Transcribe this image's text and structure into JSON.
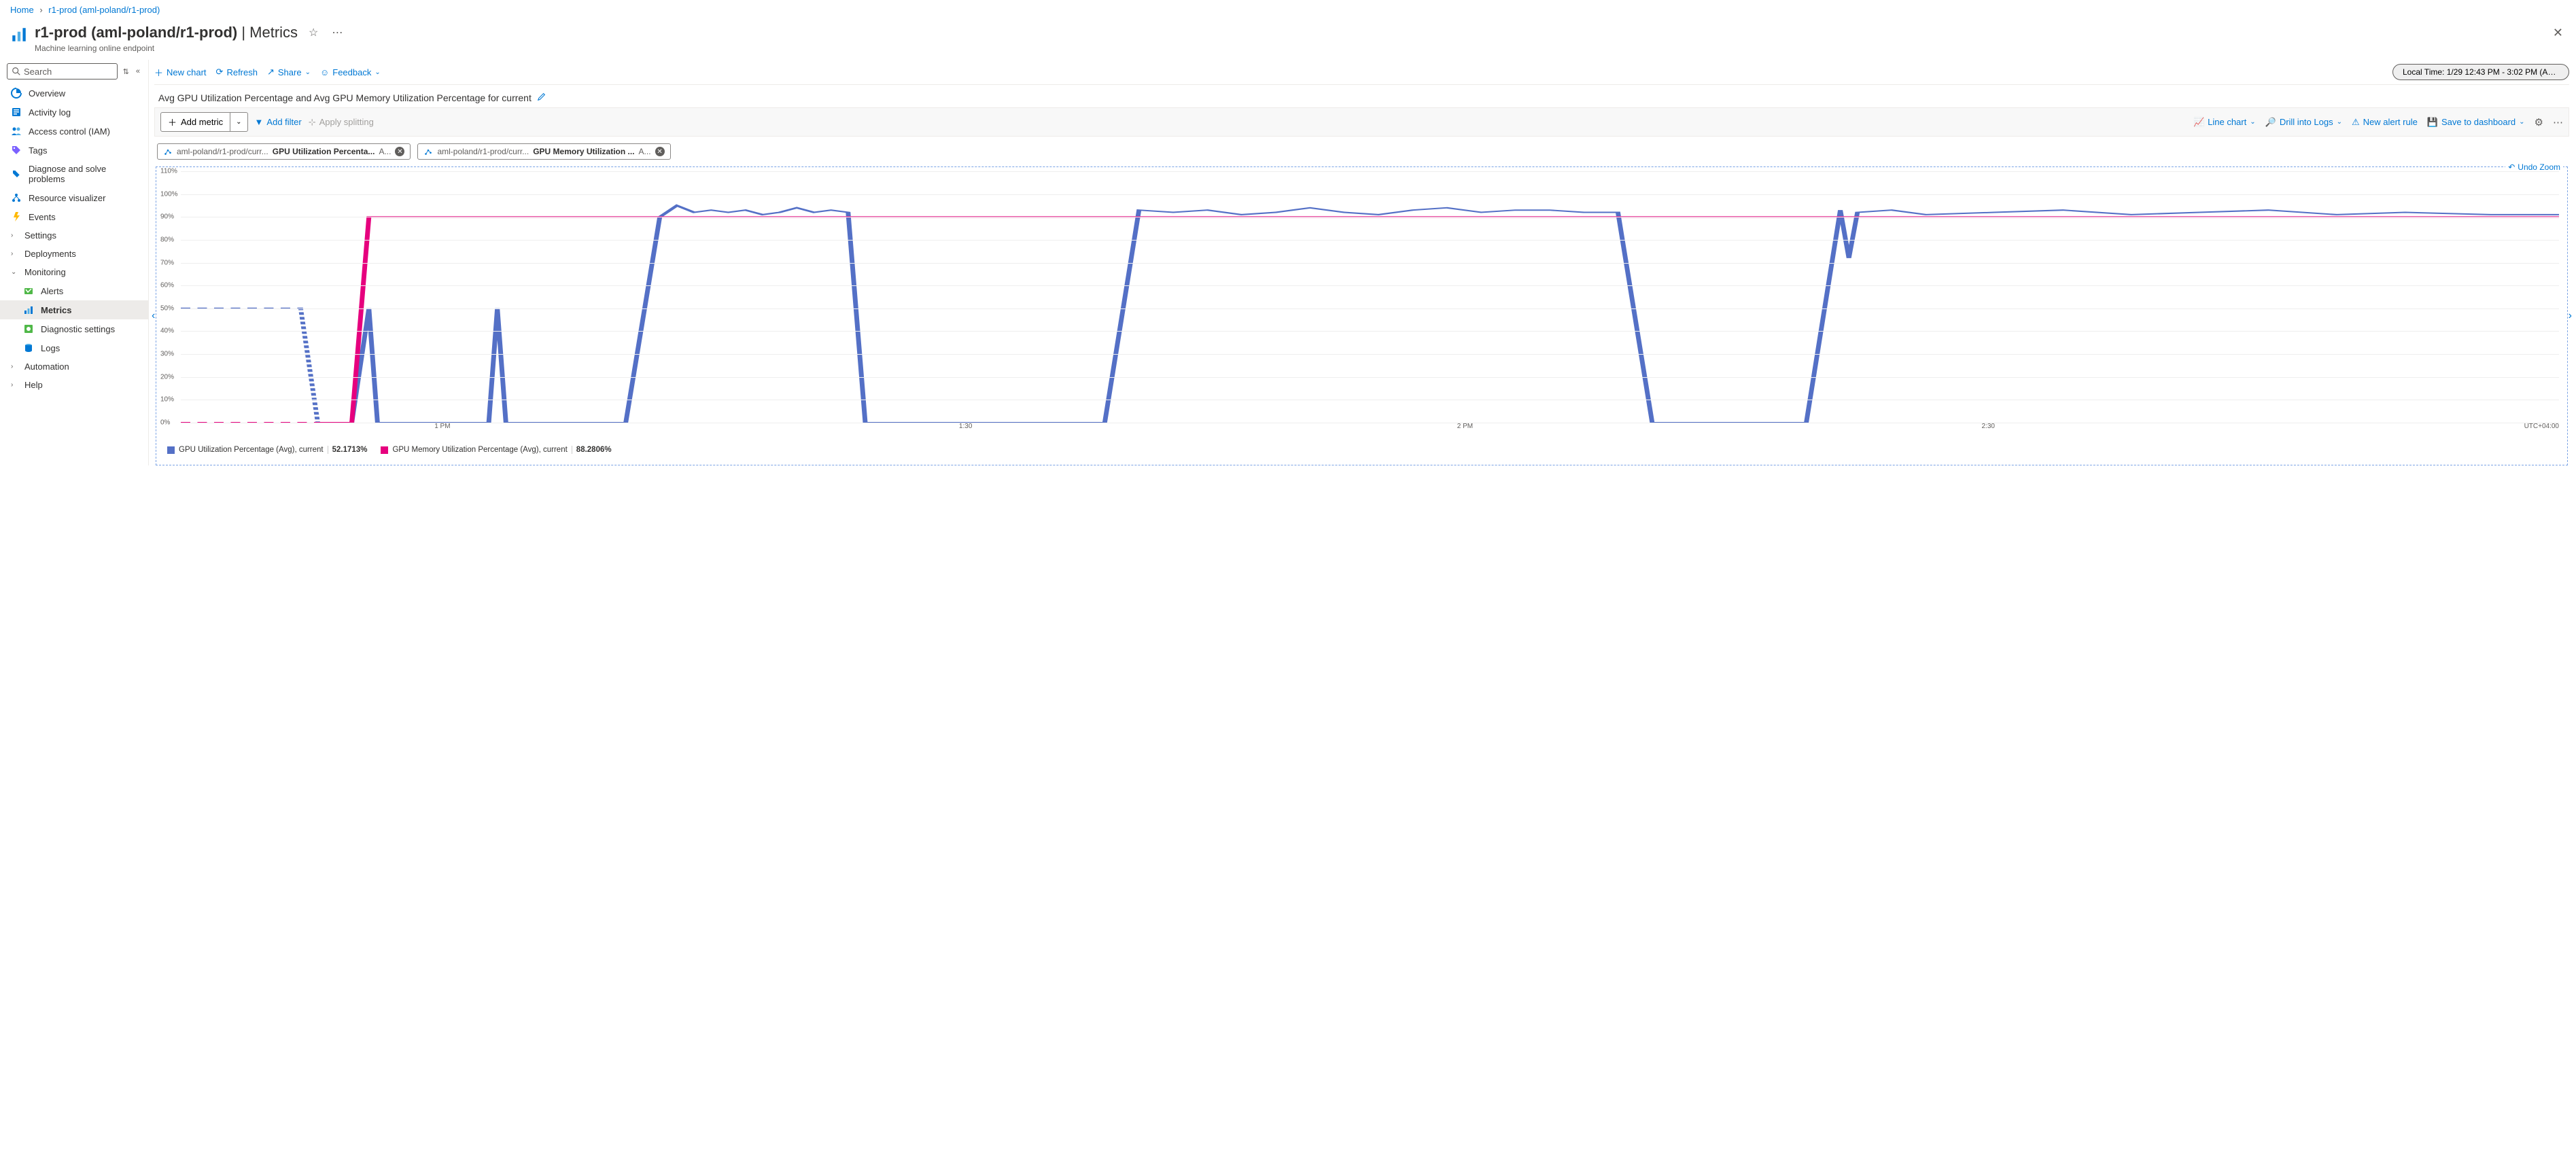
{
  "breadcrumb": {
    "home": "Home",
    "current": "r1-prod (aml-poland/r1-prod)"
  },
  "header": {
    "title_prefix": "r1-prod (aml-poland/r1-prod)",
    "title_suffix": " | Metrics",
    "subtitle": "Machine learning online endpoint"
  },
  "search_placeholder": "Search",
  "sidebar": [
    {
      "icon": "overview",
      "label": "Overview"
    },
    {
      "icon": "activity",
      "label": "Activity log"
    },
    {
      "icon": "access",
      "label": "Access control (IAM)"
    },
    {
      "icon": "tags",
      "label": "Tags"
    },
    {
      "icon": "diagnose",
      "label": "Diagnose and solve problems"
    },
    {
      "icon": "resource",
      "label": "Resource visualizer"
    },
    {
      "icon": "events",
      "label": "Events"
    },
    {
      "chevron": ">",
      "label": "Settings"
    },
    {
      "chevron": ">",
      "label": "Deployments"
    },
    {
      "chevron": "v",
      "label": "Monitoring"
    },
    {
      "sub": true,
      "icon": "alerts",
      "label": "Alerts"
    },
    {
      "sub": true,
      "icon": "metrics",
      "label": "Metrics",
      "selected": true
    },
    {
      "sub": true,
      "icon": "diag",
      "label": "Diagnostic settings"
    },
    {
      "sub": true,
      "icon": "logs",
      "label": "Logs"
    },
    {
      "chevron": ">",
      "label": "Automation"
    },
    {
      "chevron": ">",
      "label": "Help"
    }
  ],
  "top_actions": {
    "new_chart": "New chart",
    "refresh": "Refresh",
    "share": "Share",
    "feedback": "Feedback",
    "time_range": "Local Time: 1/29 12:43 PM - 3:02 PM (Automatic..."
  },
  "chart_title": "Avg GPU Utilization Percentage and Avg GPU Memory Utilization Percentage for current",
  "toolbar": {
    "add_metric": "Add metric",
    "add_filter": "Add filter",
    "apply_splitting": "Apply splitting",
    "line_chart": "Line chart",
    "drill_logs": "Drill into Logs",
    "new_alert": "New alert rule",
    "save_dash": "Save to dashboard"
  },
  "metric_pills": [
    {
      "scope": "aml-poland/r1-prod/curr...",
      "name": "GPU Utilization Percenta...",
      "agg": "A..."
    },
    {
      "scope": "aml-poland/r1-prod/curr...",
      "name": "GPU Memory Utilization ...",
      "agg": "A..."
    }
  ],
  "undo_zoom": "Undo Zoom",
  "legend": [
    {
      "color": "blue",
      "label": "GPU Utilization Percentage (Avg), current",
      "value": "52.1713%"
    },
    {
      "color": "pink",
      "label": "GPU Memory Utilization Percentage (Avg), current",
      "value": "88.2806%"
    }
  ],
  "y_ticks": [
    "110%",
    "100%",
    "90%",
    "80%",
    "70%",
    "60%",
    "50%",
    "40%",
    "30%",
    "20%",
    "10%",
    "0%"
  ],
  "x_ticks": [
    {
      "pos": 11,
      "label": "1 PM"
    },
    {
      "pos": 33,
      "label": "1:30"
    },
    {
      "pos": 54,
      "label": "2 PM"
    },
    {
      "pos": 76,
      "label": "2:30"
    }
  ],
  "tz": "UTC+04:00",
  "chart_data": {
    "type": "line",
    "xlabel": "",
    "ylabel": "",
    "ylim": [
      0,
      110
    ],
    "x_range_minutes": [
      0,
      139
    ],
    "series": [
      {
        "name": "GPU Utilization Percentage (Avg), current",
        "color": "#5470c6",
        "dashed_until_x": 8,
        "values": [
          [
            0,
            50
          ],
          [
            7,
            50
          ],
          [
            8,
            0
          ],
          [
            9,
            0
          ],
          [
            10,
            0
          ],
          [
            11,
            50
          ],
          [
            11.5,
            0
          ],
          [
            13,
            0
          ],
          [
            18,
            0
          ],
          [
            18.5,
            50
          ],
          [
            19,
            0
          ],
          [
            26,
            0
          ],
          [
            28,
            90
          ],
          [
            29,
            95
          ],
          [
            30,
            92
          ],
          [
            31,
            93
          ],
          [
            32,
            92
          ],
          [
            33,
            93
          ],
          [
            34,
            91
          ],
          [
            35,
            92
          ],
          [
            36,
            94
          ],
          [
            37,
            92
          ],
          [
            38,
            93
          ],
          [
            39,
            92
          ],
          [
            40,
            0
          ],
          [
            54,
            0
          ],
          [
            56,
            93
          ],
          [
            58,
            92
          ],
          [
            60,
            93
          ],
          [
            62,
            91
          ],
          [
            64,
            92
          ],
          [
            66,
            94
          ],
          [
            68,
            92
          ],
          [
            70,
            91
          ],
          [
            72,
            93
          ],
          [
            74,
            94
          ],
          [
            76,
            92
          ],
          [
            78,
            93
          ],
          [
            80,
            93
          ],
          [
            82,
            92
          ],
          [
            84,
            92
          ],
          [
            86,
            0
          ],
          [
            95,
            0
          ],
          [
            97,
            93
          ],
          [
            97.5,
            72
          ],
          [
            98,
            92
          ],
          [
            100,
            93
          ],
          [
            102,
            91
          ],
          [
            106,
            92
          ],
          [
            110,
            93
          ],
          [
            114,
            91
          ],
          [
            118,
            92
          ],
          [
            122,
            93
          ],
          [
            126,
            91
          ],
          [
            130,
            92
          ],
          [
            135,
            91
          ],
          [
            139,
            91
          ]
        ]
      },
      {
        "name": "GPU Memory Utilization Percentage (Avg), current",
        "color": "#e6007e",
        "dashed_until_x": 8,
        "values": [
          [
            0,
            0
          ],
          [
            8,
            0
          ],
          [
            10,
            0
          ],
          [
            11,
            90
          ],
          [
            12,
            90
          ],
          [
            40,
            90
          ],
          [
            80,
            90
          ],
          [
            120,
            90
          ],
          [
            139,
            90
          ]
        ]
      }
    ]
  }
}
